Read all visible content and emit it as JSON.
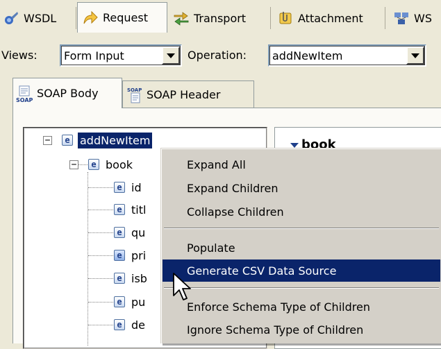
{
  "tabs": [
    {
      "label": "WSDL",
      "icon": "wsdl-icon"
    },
    {
      "label": "Request",
      "icon": "request-arrow-icon",
      "active": true
    },
    {
      "label": "Transport",
      "icon": "transport-arrows-icon"
    },
    {
      "label": "Attachment",
      "icon": "attachment-clip-icon"
    },
    {
      "label": "WS",
      "icon": "ws-security-icon"
    }
  ],
  "views": {
    "label": "Views:",
    "value": "Form Input"
  },
  "operation": {
    "label": "Operation:",
    "value": "addNewItem"
  },
  "inner_tabs": [
    {
      "label": "SOAP Body",
      "icon": "soap-body-icon",
      "active": true
    },
    {
      "label": "SOAP Header",
      "icon": "soap-header-icon"
    }
  ],
  "tree": {
    "root": "addNewItem",
    "child": "book",
    "leaves": [
      "id",
      "titl",
      "qu",
      "pri",
      "isb",
      "pu",
      "de"
    ],
    "element_glyph": "e"
  },
  "detail": {
    "title": "book"
  },
  "context_menu": {
    "group1": [
      "Expand All",
      "Expand Children",
      "Collapse Children"
    ],
    "group2": [
      "Populate",
      "Generate CSV Data Source"
    ],
    "group3": [
      "Enforce Schema Type of Children",
      "Ignore Schema Type of Children"
    ],
    "highlighted": "Generate CSV Data Source"
  },
  "colors": {
    "selection": "#0a246a",
    "chrome": "#ece9d8",
    "menu": "#d4d0c8"
  }
}
